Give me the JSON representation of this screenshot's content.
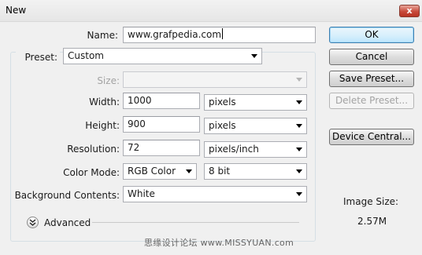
{
  "window": {
    "title": "New",
    "close_glyph": "x"
  },
  "name": {
    "label": "Name:",
    "value": "www.grafpedia.com"
  },
  "preset": {
    "label": "Preset:",
    "value": "Custom"
  },
  "size": {
    "label": "Size:",
    "value": ""
  },
  "width": {
    "label": "Width:",
    "value": "1000",
    "unit": "pixels"
  },
  "height": {
    "label": "Height:",
    "value": "900",
    "unit": "pixels"
  },
  "resolution": {
    "label": "Resolution:",
    "value": "72",
    "unit": "pixels/inch"
  },
  "color_mode": {
    "label": "Color Mode:",
    "mode": "RGB Color",
    "depth": "8 bit"
  },
  "background": {
    "label": "Background Contents:",
    "value": "White"
  },
  "advanced": {
    "label": "Advanced",
    "icon": "chevron-double-down-icon"
  },
  "buttons": {
    "ok": "OK",
    "cancel": "Cancel",
    "save_preset": "Save Preset...",
    "delete_preset": "Delete Preset...",
    "device_central": "Device Central..."
  },
  "image_size": {
    "label": "Image Size:",
    "value": "2.57M"
  },
  "watermark": "思缘设计论坛 www.MISSYUAN.com",
  "colors": {
    "default_button_border": "#3c7fb1",
    "close_button": "#c8493a"
  }
}
